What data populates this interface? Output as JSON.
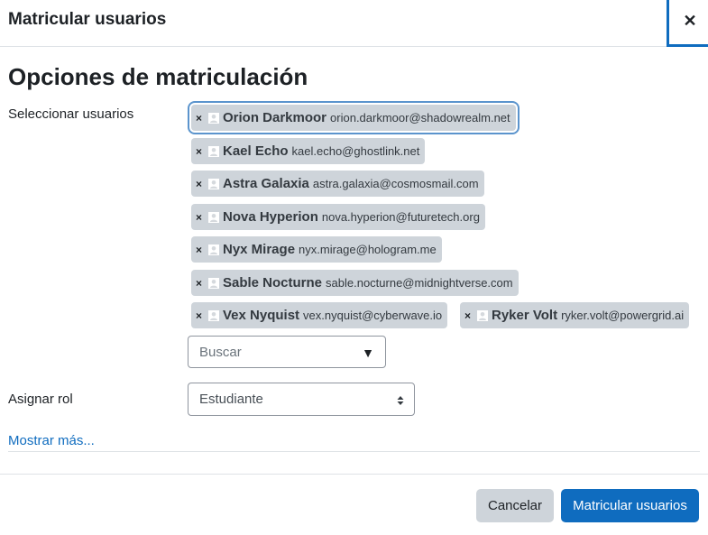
{
  "dialog": {
    "title": "Matricular usuarios",
    "close_symbol": "✕"
  },
  "section": {
    "heading": "Opciones de matriculación"
  },
  "select_users": {
    "label": "Seleccionar usuarios",
    "remove_symbol": "×",
    "selected": [
      {
        "name": "Orion Darkmoor",
        "email": "orion.darkmoor@shadowrealm.net"
      },
      {
        "name": "Kael Echo",
        "email": "kael.echo@ghostlink.net"
      },
      {
        "name": "Astra Galaxia",
        "email": "astra.galaxia@cosmosmail.com"
      },
      {
        "name": "Nova Hyperion",
        "email": "nova.hyperion@futuretech.org"
      },
      {
        "name": "Nyx Mirage",
        "email": "nyx.mirage@hologram.me"
      },
      {
        "name": "Sable Nocturne",
        "email": "sable.nocturne@midnightverse.com"
      },
      {
        "name": "Vex Nyquist",
        "email": "vex.nyquist@cyberwave.io"
      },
      {
        "name": "Ryker Volt",
        "email": "ryker.volt@powergrid.ai"
      }
    ],
    "search_placeholder": "Buscar",
    "search_caret": "▼"
  },
  "assign_role": {
    "label": "Asignar rol",
    "selected_value": "Estudiante"
  },
  "show_more": "Mostrar más...",
  "footer": {
    "cancel_label": "Cancelar",
    "submit_label": "Matricular usuarios"
  },
  "colors": {
    "primary": "#0f6cbf",
    "chip_bg": "#ced4da",
    "focus_ring": "#5b94cd"
  }
}
